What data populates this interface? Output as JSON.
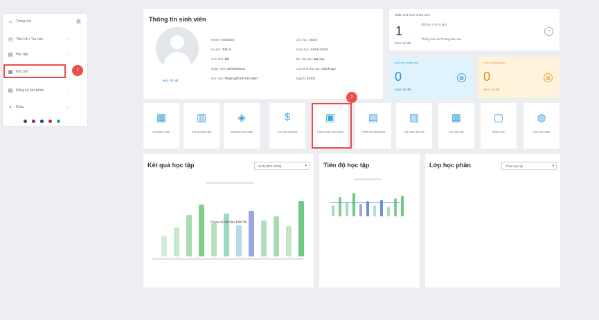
{
  "sidebar": {
    "items": [
      {
        "label": "Trang chủ",
        "icon": "home-icon",
        "glyph": "⌂"
      },
      {
        "label": "Tiện ích / Tra cứu",
        "icon": "clock-icon",
        "glyph": "◷"
      },
      {
        "label": "Học tập",
        "icon": "study-icon",
        "glyph": "▤"
      },
      {
        "label": "Học phí",
        "icon": "wallet-icon",
        "glyph": "▦"
      },
      {
        "label": "Đăng ký học phần",
        "icon": "register-icon",
        "glyph": "▤"
      },
      {
        "label": "Khác",
        "icon": "more-icon",
        "glyph": "▪"
      }
    ],
    "theme_colors": [
      "#3b3f8f",
      "#6a2a8a",
      "#1a3fa0",
      "#c8202a",
      "#2aa08a"
    ]
  },
  "step_badges": {
    "one": "1",
    "two": "2"
  },
  "student": {
    "title": "Thông tin sinh viên",
    "view_detail": "Xem chi tiết",
    "left_rows": [
      {
        "k": "MSSV:",
        "v": "XXXXXX"
      },
      {
        "k": "Họ tên:",
        "v": "Trần X"
      },
      {
        "k": "Giới tính:",
        "v": "Nữ"
      },
      {
        "k": "Ngày sinh:",
        "v": "XX/XX/XXXX"
      },
      {
        "k": "Nơi sinh:",
        "v": "Thành phố Hồ Chí Minh"
      }
    ],
    "right_rows": [
      {
        "k": "Lớp học:",
        "v": "XXXX"
      },
      {
        "k": "Khóa học:",
        "v": "XXXX-XXXX"
      },
      {
        "k": "Bậc đào tạo:",
        "v": "Đại học"
      },
      {
        "k": "Loại hình đào tạo:",
        "v": "Chính quy"
      },
      {
        "k": "Ngành:",
        "v": "XXXX"
      }
    ]
  },
  "reminder": {
    "heading": "Nhắc nhở mới, chưa xem",
    "count": "1",
    "line1": "Không có lịch nghỉ",
    "line2": "Thông báo từ Phòng Đào tạo",
    "view_detail": "Xem chi tiết"
  },
  "schedule_week": {
    "label": "Lịch học trong tuần",
    "count": "0",
    "view_detail": "Xem chi tiết"
  },
  "exam_week": {
    "label": "Lịch thi trong tuần",
    "count": "0",
    "view_detail": "Xem chi tiết"
  },
  "tiles": [
    {
      "label": "Lịch theo tuần",
      "icon": "calendar-week-icon",
      "glyph": "▦"
    },
    {
      "label": "Kết quả học tập",
      "icon": "bar-chart-icon",
      "glyph": "▥"
    },
    {
      "label": "Đăng ký học phần",
      "icon": "layers-icon",
      "glyph": "◈"
    },
    {
      "label": "Tra cứu công nợ",
      "icon": "dollar-icon",
      "glyph": "$"
    },
    {
      "label": "Thanh toán trực tuyến",
      "icon": "receipt-icon",
      "glyph": "▣"
    },
    {
      "label": "Phiếu thu tổng hợp",
      "icon": "document-icon",
      "glyph": "▤"
    },
    {
      "label": "Lịch theo tiến độ",
      "icon": "list-calendar-icon",
      "glyph": "▥"
    },
    {
      "label": "Lịch theo kỳ",
      "icon": "calendar-icon",
      "glyph": "▦"
    },
    {
      "label": "Nhắc nhở",
      "icon": "bell-icon",
      "glyph": "▢"
    },
    {
      "label": "Lớp học phần",
      "icon": "gift-icon",
      "glyph": "◍"
    }
  ],
  "results_chart": {
    "title": "Kết quả học tập",
    "select_value": "HK1(2022-2023)",
    "empty_note": "Chưa có dữ liệu hiển thị"
  },
  "progress_chart": {
    "title": "Tiến độ học tập"
  },
  "classes": {
    "title": "Lớp học phần",
    "select_value": "Chọn học kỳ"
  }
}
